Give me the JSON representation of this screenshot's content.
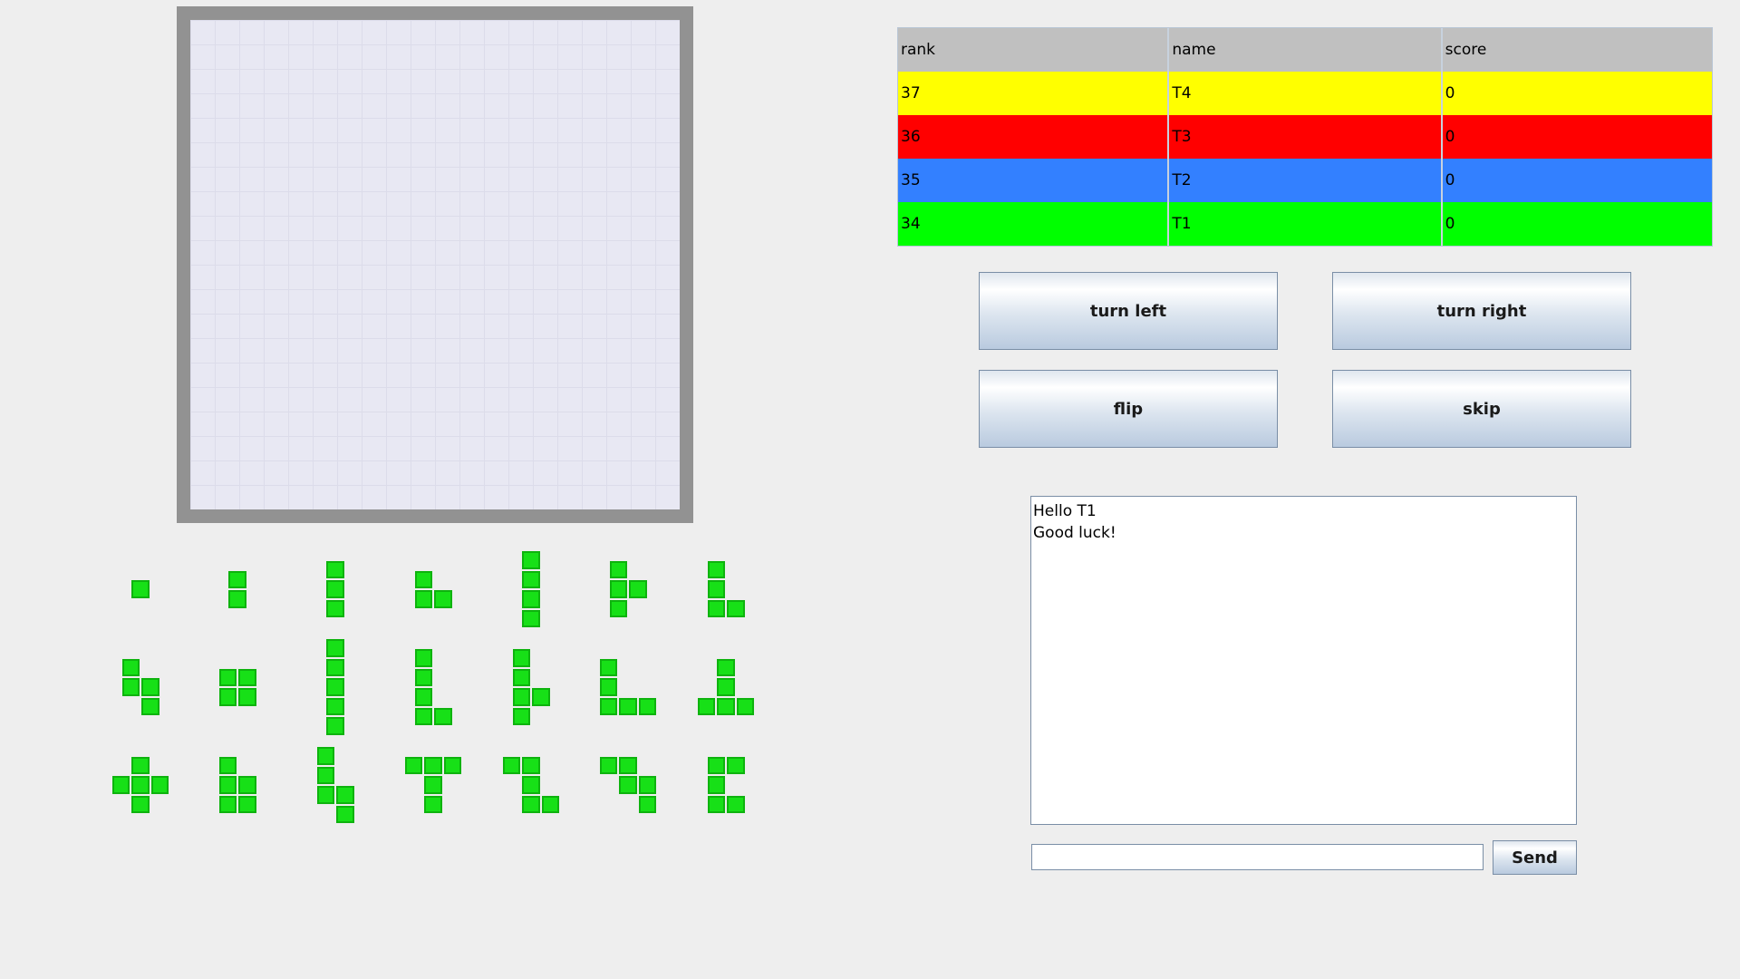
{
  "score_table": {
    "headers": [
      "rank",
      "name",
      "score"
    ],
    "rows": [
      {
        "rank": "37",
        "name": "T4",
        "score": "0",
        "color": "#ffff00"
      },
      {
        "rank": "36",
        "name": "T3",
        "score": "0",
        "color": "#ff0000"
      },
      {
        "rank": "35",
        "name": "T2",
        "score": "0",
        "color": "#3380ff"
      },
      {
        "rank": "34",
        "name": "T1",
        "score": "0",
        "color": "#00ff00"
      }
    ]
  },
  "controls": {
    "turn_left": "turn left",
    "turn_right": "turn right",
    "flip": "flip",
    "skip": "skip"
  },
  "chat": {
    "messages": [
      "Hello T1",
      "Good luck!"
    ],
    "input_value": "",
    "send_label": "Send"
  },
  "colors": {
    "piece_fill": "#17e017",
    "piece_border": "#0eb30e",
    "board_frame": "#929292",
    "board_background": "#e8e8f3"
  },
  "pieces": [
    [
      [
        0,
        0
      ]
    ],
    [
      [
        0,
        0
      ],
      [
        0,
        1
      ]
    ],
    [
      [
        0,
        0
      ],
      [
        0,
        1
      ],
      [
        0,
        2
      ]
    ],
    [
      [
        0,
        0
      ],
      [
        0,
        1
      ],
      [
        1,
        1
      ]
    ],
    [
      [
        0,
        0
      ],
      [
        0,
        1
      ],
      [
        0,
        2
      ],
      [
        0,
        3
      ]
    ],
    [
      [
        0,
        0
      ],
      [
        0,
        1
      ],
      [
        1,
        1
      ],
      [
        0,
        2
      ]
    ],
    [
      [
        0,
        0
      ],
      [
        0,
        1
      ],
      [
        0,
        2
      ],
      [
        1,
        2
      ]
    ],
    [
      [
        0,
        0
      ],
      [
        0,
        1
      ],
      [
        1,
        1
      ],
      [
        1,
        2
      ]
    ],
    [
      [
        0,
        0
      ],
      [
        1,
        0
      ],
      [
        0,
        1
      ],
      [
        1,
        1
      ]
    ],
    [
      [
        0,
        0
      ],
      [
        0,
        1
      ],
      [
        0,
        2
      ],
      [
        0,
        3
      ],
      [
        0,
        4
      ]
    ],
    [
      [
        0,
        0
      ],
      [
        0,
        1
      ],
      [
        0,
        2
      ],
      [
        0,
        3
      ],
      [
        1,
        3
      ]
    ],
    [
      [
        0,
        0
      ],
      [
        0,
        1
      ],
      [
        0,
        2
      ],
      [
        1,
        2
      ],
      [
        0,
        3
      ]
    ],
    [
      [
        0,
        0
      ],
      [
        0,
        1
      ],
      [
        0,
        2
      ],
      [
        1,
        2
      ],
      [
        2,
        2
      ]
    ],
    [
      [
        1,
        0
      ],
      [
        1,
        1
      ],
      [
        0,
        2
      ],
      [
        1,
        2
      ],
      [
        2,
        2
      ]
    ],
    [
      [
        1,
        0
      ],
      [
        0,
        1
      ],
      [
        1,
        1
      ],
      [
        2,
        1
      ],
      [
        1,
        2
      ]
    ],
    [
      [
        0,
        0
      ],
      [
        0,
        1
      ],
      [
        1,
        1
      ],
      [
        0,
        2
      ],
      [
        1,
        2
      ]
    ],
    [
      [
        0,
        0
      ],
      [
        0,
        1
      ],
      [
        0,
        2
      ],
      [
        1,
        2
      ],
      [
        1,
        3
      ]
    ],
    [
      [
        0,
        0
      ],
      [
        1,
        0
      ],
      [
        2,
        0
      ],
      [
        1,
        1
      ],
      [
        1,
        2
      ]
    ],
    [
      [
        0,
        0
      ],
      [
        1,
        0
      ],
      [
        1,
        1
      ],
      [
        1,
        2
      ],
      [
        2,
        2
      ]
    ],
    [
      [
        0,
        0
      ],
      [
        1,
        0
      ],
      [
        1,
        1
      ],
      [
        2,
        1
      ],
      [
        2,
        2
      ]
    ],
    [
      [
        0,
        0
      ],
      [
        1,
        0
      ],
      [
        0,
        1
      ],
      [
        0,
        2
      ],
      [
        1,
        2
      ]
    ]
  ]
}
